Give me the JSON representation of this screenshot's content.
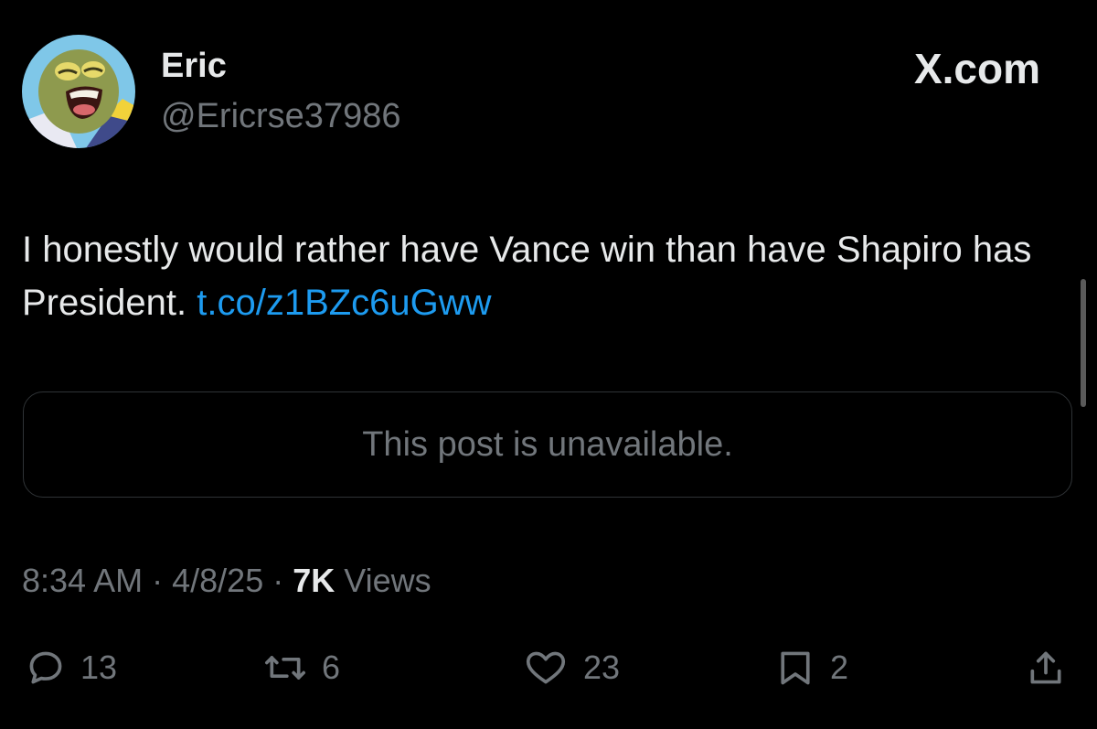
{
  "author": {
    "display_name": "Eric",
    "handle": "@Ericrse37986",
    "avatar_icon": "cartoon-fish-avatar"
  },
  "brand": {
    "label": "X.com"
  },
  "post": {
    "text": "I honestly would rather have Vance win than have Shapiro has President.",
    "link": "t.co/z1BZc6uGww",
    "link_color": "#1d9bf0"
  },
  "quoted_post": {
    "message": "This post is unavailable."
  },
  "meta": {
    "time": "8:34 AM",
    "separator": "·",
    "date": "4/8/25",
    "views_count": "7K",
    "views_label": "Views"
  },
  "actions": {
    "replies": {
      "icon": "reply-icon",
      "count": "13"
    },
    "reposts": {
      "icon": "repost-icon",
      "count": "6"
    },
    "likes": {
      "icon": "heart-icon",
      "count": "23"
    },
    "bookmarks": {
      "icon": "bookmark-icon",
      "count": "2"
    },
    "share": {
      "icon": "share-icon"
    }
  },
  "colors": {
    "background": "#000000",
    "primary_text": "#e7e9ea",
    "secondary_text": "#71767b",
    "border": "#2f3336",
    "accent": "#1d9bf0"
  }
}
